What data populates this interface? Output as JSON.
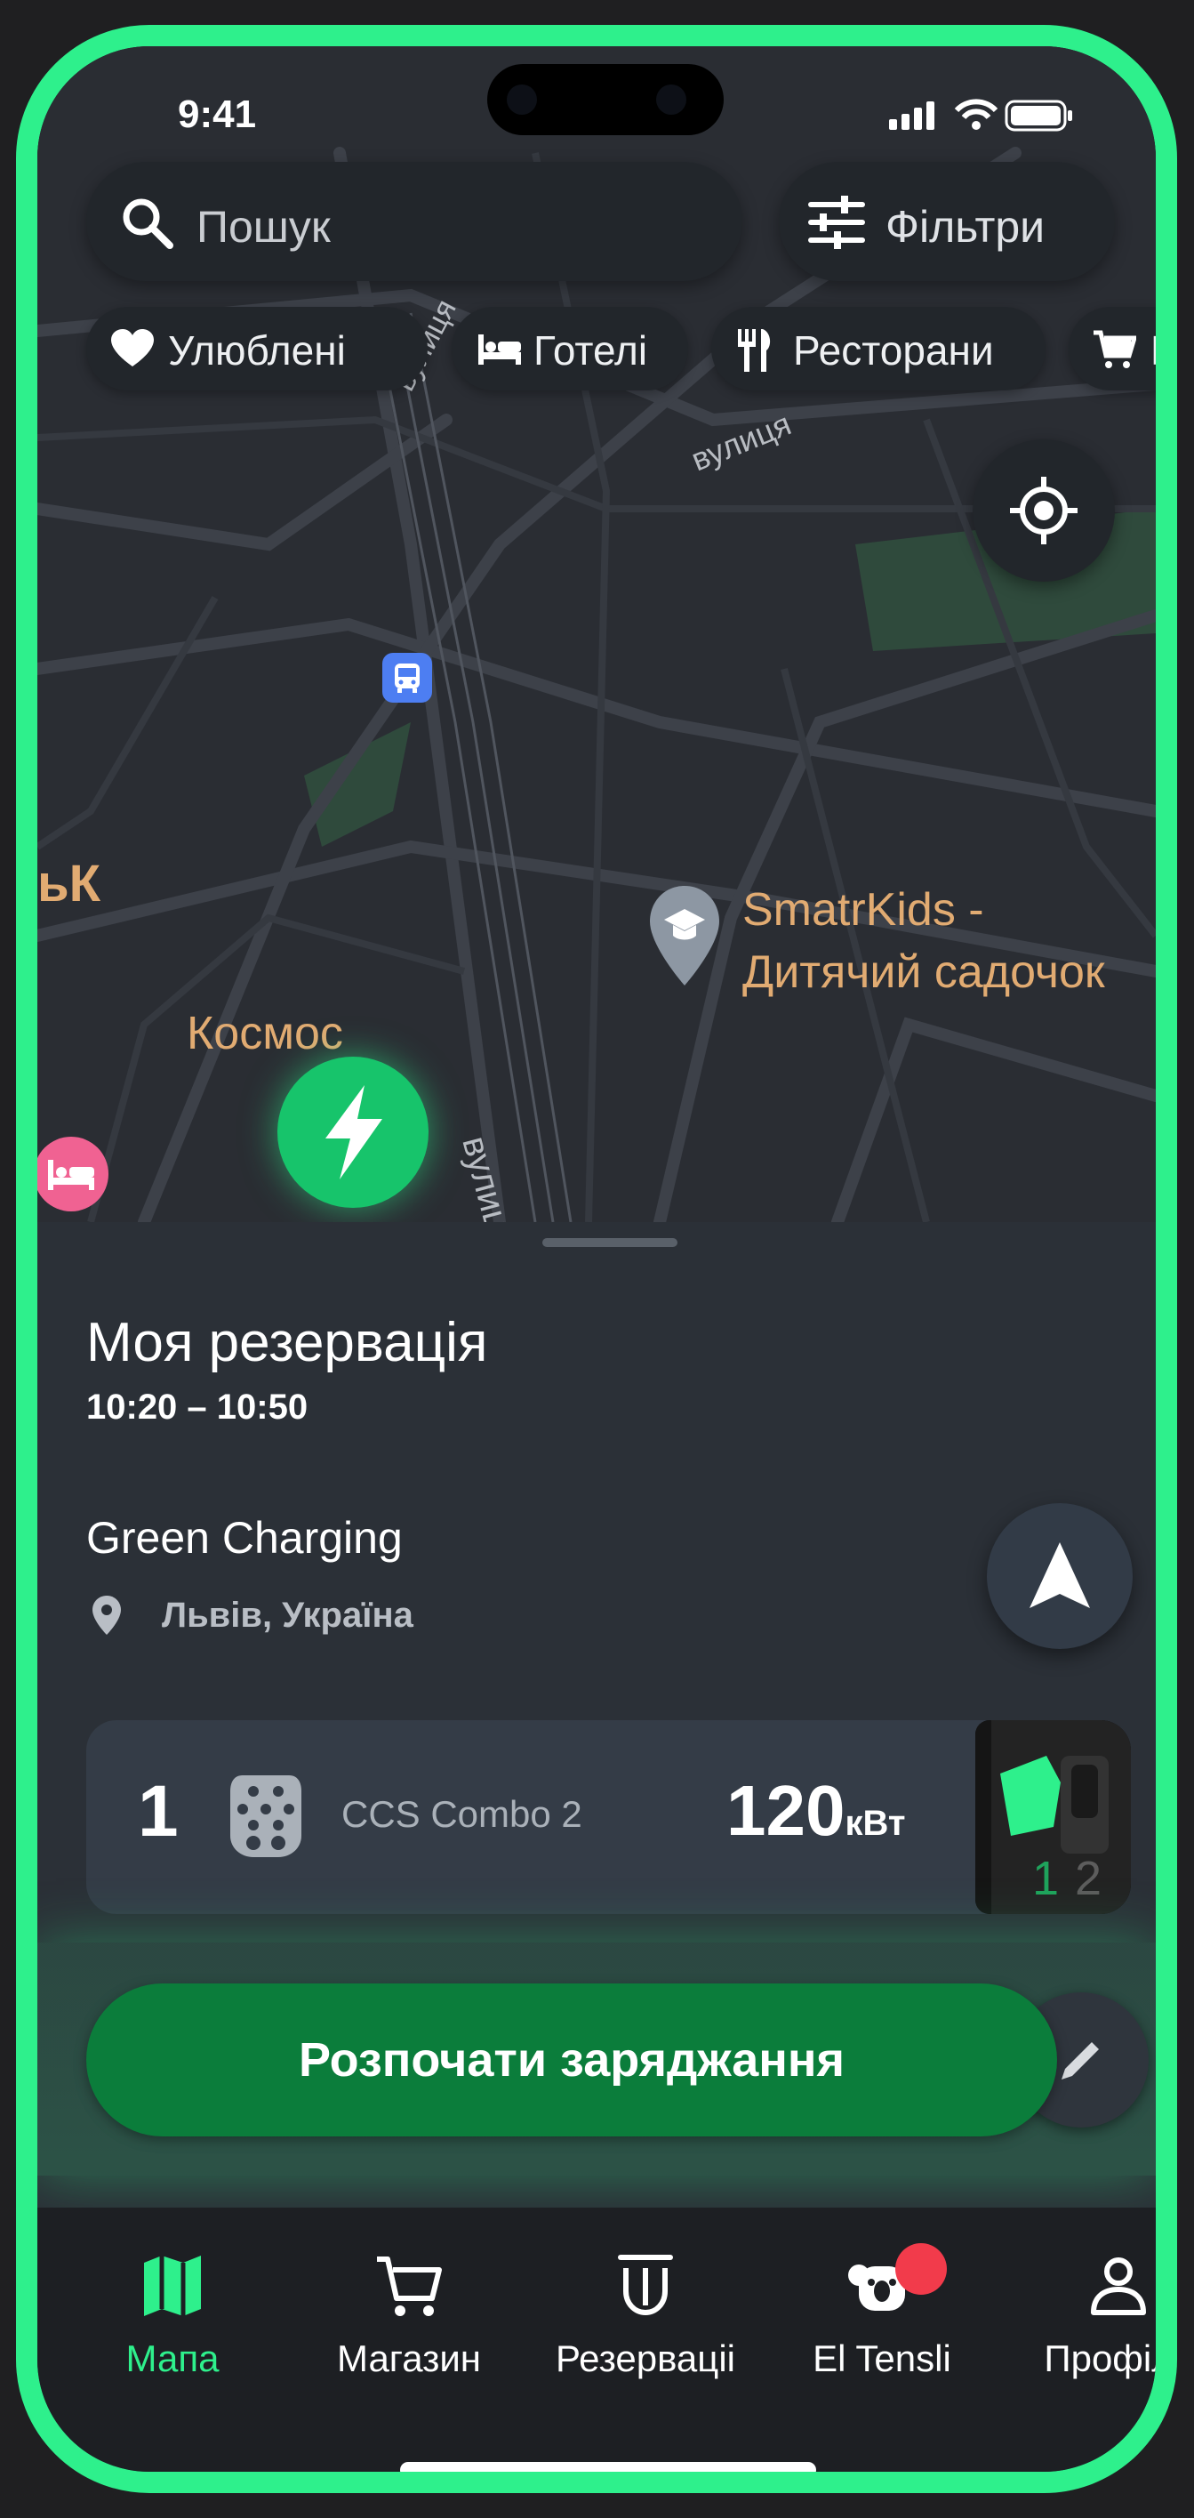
{
  "status_bar": {
    "time": "9:41"
  },
  "search": {
    "placeholder": "Пошук",
    "filters_label": "Фільтри"
  },
  "chips": [
    {
      "label": "Улюблені",
      "icon": "heart-icon"
    },
    {
      "label": "Готелі",
      "icon": "bed-icon"
    },
    {
      "label": "Ресторани",
      "icon": "fork-knife-icon"
    },
    {
      "label": "Пр",
      "icon": "cart-icon"
    }
  ],
  "map": {
    "street_1": "вулиця Залізнична",
    "street_2": "вулиця",
    "street_3": "вулиця",
    "poi_school": "SmatrKids -\nДитячий садочок",
    "poi_k": "ьК",
    "poi_kosmos": "Космос"
  },
  "reservation": {
    "title": "Моя резервація",
    "time_range": "10:20 – 10:50",
    "station_name": "Green Charging",
    "location": "Львів, Україна"
  },
  "connector": {
    "number": "1",
    "type": "CCS Combo 2",
    "power": "120",
    "unit": "кВт",
    "photo_labels": [
      "1",
      "2"
    ]
  },
  "start_button_label": "Розпочати заряджання",
  "tabs": [
    {
      "label": "Мапа",
      "icon": "map-icon",
      "active": true
    },
    {
      "label": "Магазин",
      "icon": "cart-icon",
      "active": false
    },
    {
      "label": "Резерваціі",
      "icon": "reservation-icon",
      "active": false
    },
    {
      "label": "El Tensli",
      "icon": "koala-icon",
      "active": false
    },
    {
      "label": "Профіль",
      "icon": "profile-icon",
      "active": false
    }
  ],
  "colors": {
    "accent": "#2ef08c",
    "button_green": "#0b7d3b",
    "badge_red": "#f23b4b",
    "poi_label": "#e1ab72"
  }
}
